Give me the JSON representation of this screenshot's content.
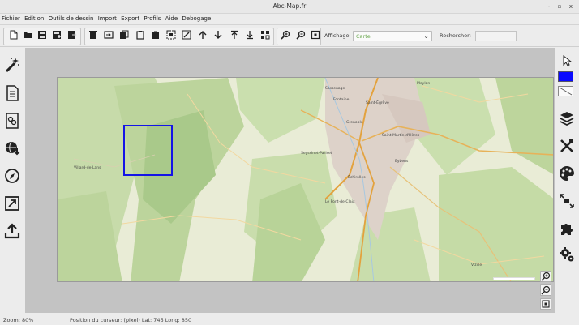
{
  "window": {
    "title": "Abc-Map.fr"
  },
  "window_controls": {
    "minimize": "-",
    "maximize": "▫",
    "close": "x"
  },
  "menu": [
    "Fichier",
    "Edition",
    "Outils de dessin",
    "Import",
    "Export",
    "Profils",
    "Aide",
    "Debogage"
  ],
  "toolbar": {
    "affichage_label": "Affichage",
    "affichage_value": "Carte",
    "search_label": "Rechercher:",
    "search_value": "",
    "file_icons": [
      "new-file-icon",
      "open-folder-icon",
      "save-icon",
      "save-as-icon",
      "export-file-icon"
    ],
    "edit_icons": [
      "delete-icon",
      "import-layer-icon",
      "copy-icon",
      "paste-icon",
      "clipboard-icon",
      "duplicate-icon",
      "magic-edit-icon",
      "arrow-up-icon",
      "arrow-down-icon",
      "arrow-top-icon",
      "arrow-bottom-icon",
      "grid-icon"
    ],
    "zoom_icons": [
      "zoom-in-icon",
      "zoom-out-icon",
      "zoom-fit-icon"
    ]
  },
  "left_tools": [
    "wand-icon",
    "document-icon",
    "layers-stack-icon",
    "globe-download-icon",
    "compass-icon",
    "resize-window-icon",
    "upload-icon"
  ],
  "right_tools": [
    "pointer-icon",
    "layers-icon",
    "draw-tools-icon",
    "palette-icon",
    "expand-cube-icon",
    "puzzle-icon",
    "settings-icon"
  ],
  "colors": {
    "draw_color": "#0a0aff",
    "selection": "#1414e6",
    "map_green": "#b9d49b",
    "map_urban": "#d9d0c9",
    "map_road": "#e8a13c"
  },
  "map": {
    "labels": [
      "Grenoble",
      "Saint-Martin-d'Hères",
      "Échirolles",
      "Le Pont-de-Claix",
      "Meylan",
      "Fontaine",
      "Vizille",
      "Saint-Égrève",
      "Eybens",
      "Seyssinet-Pariset",
      "Sassenage",
      "Villard-de-Lans"
    ]
  },
  "map_controls": [
    "zoom-in-icon",
    "zoom-out-icon",
    "reset-view-icon"
  ],
  "status": {
    "zoom": "Zoom: 80%",
    "cursor": "Position du curseur: (pixel) Lat: 745 Long: 850"
  }
}
